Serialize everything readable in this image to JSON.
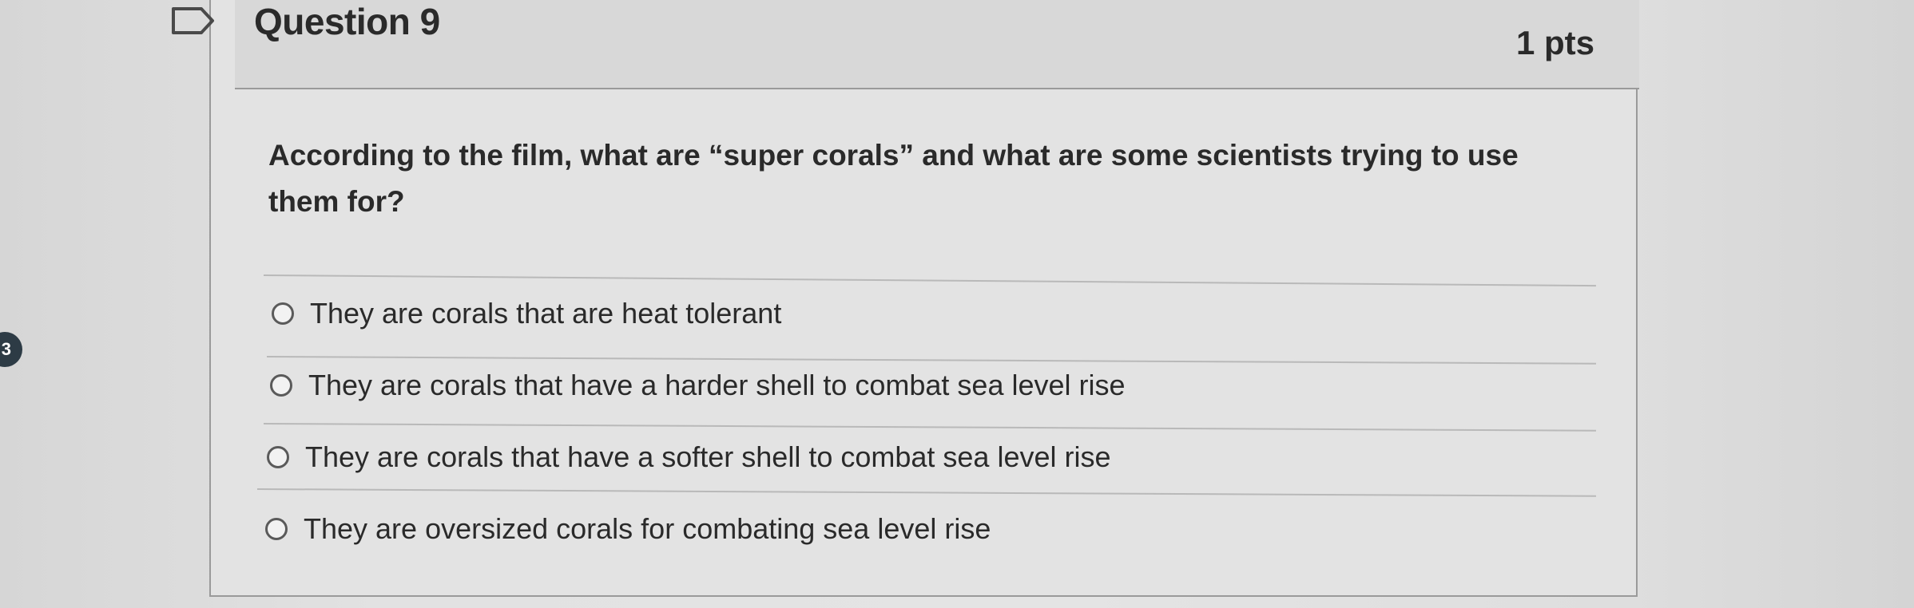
{
  "question": {
    "title": "Question 9",
    "points": "1 pts",
    "text": "According to the film, what are “super corals” and what are some scientists trying to use them for?"
  },
  "answers": [
    {
      "label": "They are corals that are heat tolerant"
    },
    {
      "label": "They are corals that have a harder shell to combat sea level rise"
    },
    {
      "label": "They are corals that have a softer shell to combat sea level rise"
    },
    {
      "label": "They are oversized corals for combating sea level rise"
    }
  ],
  "navigator": {
    "badge": "3"
  },
  "colors": {
    "text": "#2a2a2a",
    "header_bg": "#d8d8d8",
    "card_bg": "#e3e3e3",
    "border": "#9a9a9a"
  },
  "icons": {
    "flag": "bookmark-flag-icon",
    "radio": "radio-button-icon"
  }
}
